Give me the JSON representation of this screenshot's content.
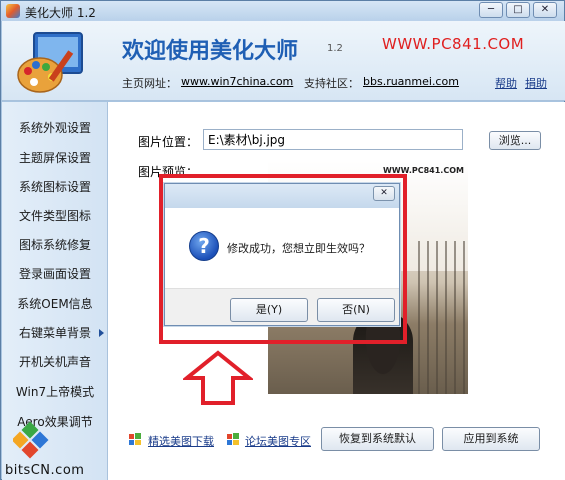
{
  "window": {
    "title": "美化大师 1.2",
    "minimize_label": "─",
    "maximize_label": "□",
    "close_label": "✕"
  },
  "header": {
    "heading": "欢迎使用美化大师",
    "version": "1.2",
    "site_mark": "WWW.PC841.COM",
    "homepage_label": "主页网址：",
    "homepage_url": "www.win7china.com",
    "support_label": "支持社区：",
    "support_url": "bbs.ruanmei.com",
    "help_label": "帮助",
    "donate_label": "捐助"
  },
  "sidebar": {
    "items": [
      {
        "label": "系统外观设置"
      },
      {
        "label": "主题屏保设置"
      },
      {
        "label": "系统图标设置"
      },
      {
        "label": "文件类型图标"
      },
      {
        "label": "图标系统修复"
      },
      {
        "label": "登录画面设置"
      },
      {
        "label": "系统OEM信息"
      },
      {
        "label": "右键菜单背景"
      },
      {
        "label": "开机关机声音"
      },
      {
        "label": "Win7上帝模式"
      },
      {
        "label": "Aero效果调节"
      }
    ],
    "active_index": 7
  },
  "main": {
    "image_path_label": "图片位置：",
    "image_path_value": "E:\\素材\\bj.jpg",
    "browse_label": "浏览...",
    "preview_label": "图片预览：",
    "preview_watermark": "WWW.PC841.COM",
    "link_wallpaper": "精选美图下载",
    "link_forum": "论坛美图专区",
    "restore_label": "恢复到系统默认",
    "apply_label": "应用到系统"
  },
  "dialog": {
    "close_label": "✕",
    "icon": "question-icon",
    "icon_glyph": "?",
    "message": "修改成功，您想立即生效吗？",
    "yes_label": "是(Y)",
    "no_label": "否(N)"
  },
  "watermark": {
    "text": "bitsCN.com"
  },
  "colors": {
    "annotation_red": "#e1202a",
    "heading_blue": "#1f5fb4",
    "site_mark_red": "#e02020"
  }
}
